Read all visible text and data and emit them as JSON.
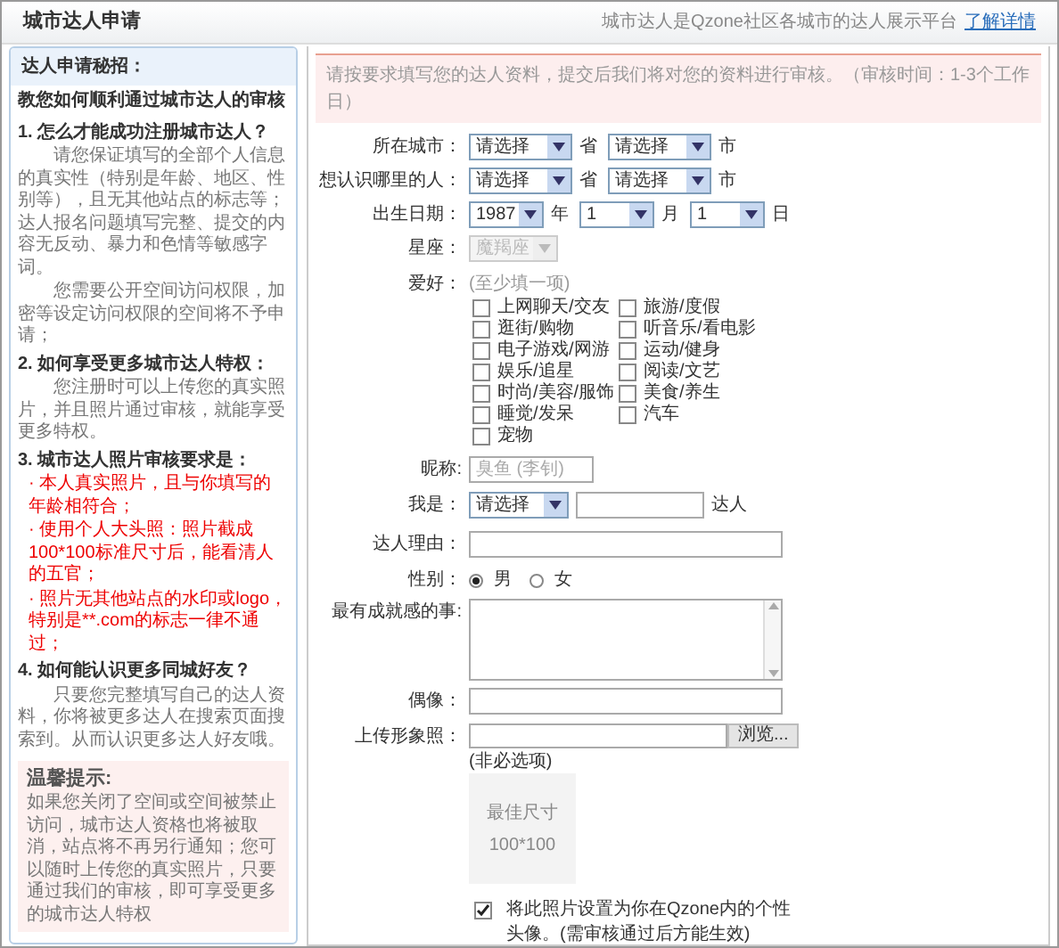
{
  "header": {
    "title": "城市达人申请",
    "intro": "城市达人是Qzone社区各城市的达人展示平台",
    "link": "了解详情"
  },
  "sidebar": {
    "heading": "达人申请秘招：",
    "subtitle": "教您如何顺利通过城市达人的审核",
    "sections": [
      {
        "title": "1. 怎么才能成功注册城市达人？",
        "paragraphs": [
          {
            "kind": "normal",
            "text": "请您保证填写的全部个人信息的真实性（特别是年龄、地区、性别等），且无其他站点的标志等；达人报名问题填写完整、提交的内容无反动、暴力和色情等敏感字词。"
          },
          {
            "kind": "normal",
            "text": "您需要公开空间访问权限，加密等设定访问权限的空间将不予申请；"
          }
        ]
      },
      {
        "title": "2. 如何享受更多城市达人特权：",
        "paragraphs": [
          {
            "kind": "normal",
            "text": "您注册时可以上传您的真实照片，并且照片通过审核，就能享受更多特权。"
          }
        ]
      },
      {
        "title": "3. 城市达人照片审核要求是：",
        "paragraphs": [
          {
            "kind": "warning",
            "text": "· 本人真实照片，且与你填写的年龄相符合；"
          },
          {
            "kind": "warning",
            "text": "· 使用个人大头照：照片截成100*100标准尺寸后，能看清人的五官；"
          },
          {
            "kind": "warning",
            "text": "· 照片无其他站点的水印或logo，特别是**.com的标志一律不通过；"
          }
        ]
      },
      {
        "title": "4. 如何能认识更多同城好友？",
        "paragraphs": [
          {
            "kind": "normal",
            "text": "只要您完整填写自己的达人资料，你将被更多达人在搜索页面搜索到。从而认识更多达人好友哦。"
          }
        ]
      }
    ],
    "tip": {
      "title": "温馨提示:",
      "text": "如果您关闭了空间或空间被禁止访问，城市达人资格也将被取消，站点将不再另行通知；您可以随时上传您的真实照片，只要通过我们的审核，即可享受更多的城市达人特权"
    }
  },
  "form": {
    "notice": "请按要求填写您的达人资料，提交后我们将对您的资料进行审核。（审核时间：1-3个工作日）",
    "fields": [
      {
        "kind": "selects",
        "label": "所在城市：",
        "selects": [
          {
            "value": "请选择",
            "unit": "省"
          },
          {
            "value": "请选择",
            "unit": "市"
          }
        ]
      },
      {
        "kind": "selects",
        "label": "想认识哪里的人：",
        "selects": [
          {
            "value": "请选择",
            "unit": "省"
          },
          {
            "value": "请选择",
            "unit": "市"
          }
        ]
      },
      {
        "kind": "selects",
        "label": "出生日期：",
        "selects": [
          {
            "value": "1987",
            "unit": "年"
          },
          {
            "value": "1",
            "unit": "月"
          },
          {
            "value": "1",
            "unit": "日"
          }
        ]
      },
      {
        "kind": "disabled_select",
        "label": "星座：",
        "value": "魔羯座",
        "disabled": true
      },
      {
        "kind": "checkboxes",
        "label": "爱好：",
        "hint": "(至少填一项)",
        "options": [
          {
            "label": "上网聊天/交友",
            "checked": false
          },
          {
            "label": "旅游/度假",
            "checked": false
          },
          {
            "label": "逛街/购物",
            "checked": false
          },
          {
            "label": "听音乐/看电影",
            "checked": false
          },
          {
            "label": "电子游戏/网游",
            "checked": false
          },
          {
            "label": "运动/健身",
            "checked": false
          },
          {
            "label": "娱乐/追星",
            "checked": false
          },
          {
            "label": "阅读/文艺",
            "checked": false
          },
          {
            "label": "时尚/美容/服饰",
            "checked": false
          },
          {
            "label": "美食/养生",
            "checked": false
          },
          {
            "label": "睡觉/发呆",
            "checked": false
          },
          {
            "label": "汽车",
            "checked": false
          },
          {
            "label": "宠物",
            "checked": false
          }
        ]
      },
      {
        "kind": "text",
        "label": "昵称:",
        "placeholder": "臭鱼 (李钊)"
      },
      {
        "kind": "select_text",
        "label": "我是：",
        "select": "请选择",
        "suffix": "达人"
      },
      {
        "kind": "text",
        "label": "达人理由："
      },
      {
        "kind": "radio",
        "label": "性别：",
        "options": [
          {
            "label": "男",
            "selected": true
          },
          {
            "label": "女",
            "selected": false
          }
        ]
      },
      {
        "kind": "textarea",
        "label": "最有成就感的事:"
      },
      {
        "kind": "text",
        "label": "偶像："
      },
      {
        "kind": "file",
        "label": "上传形象照：",
        "button": "浏览...",
        "note": "(非必选项)"
      },
      {
        "kind": "photo",
        "lines": [
          "最佳尺寸",
          "100*100"
        ]
      },
      {
        "kind": "checkbox",
        "text": "将此照片设置为你在Qzone内的个性头像。(需审核通过后方能生效)",
        "checked": true
      }
    ]
  }
}
